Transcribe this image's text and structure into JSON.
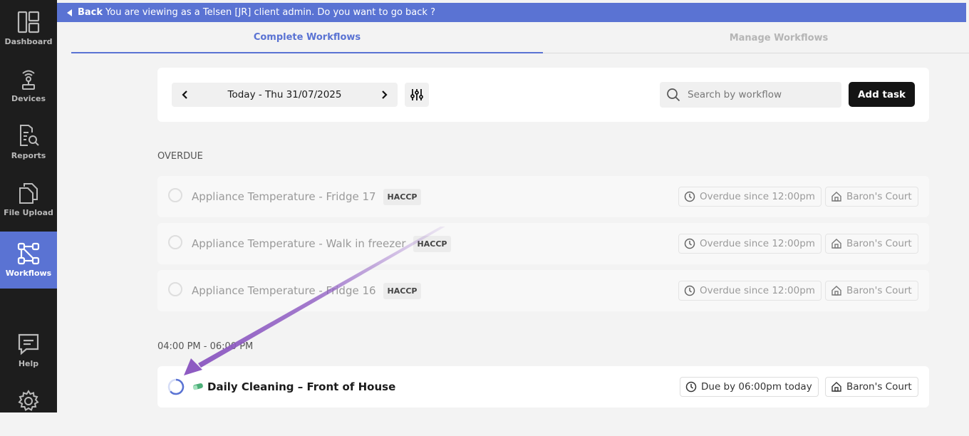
{
  "sidebar": {
    "items": [
      {
        "label": "Dashboard",
        "icon": "dashboard-icon"
      },
      {
        "label": "Devices",
        "icon": "devices-icon"
      },
      {
        "label": "Reports",
        "icon": "reports-icon"
      },
      {
        "label": "File Upload",
        "icon": "file-upload-icon"
      },
      {
        "label": "Workflows",
        "icon": "workflows-icon",
        "active": true
      },
      {
        "label": "Help",
        "icon": "help-icon"
      },
      {
        "label": "",
        "icon": "settings-icon"
      }
    ]
  },
  "banner": {
    "back_label": "Back",
    "message": "You are viewing as a Telsen [JR] client admin. Do you want to go back ?"
  },
  "tabs": [
    {
      "label": "Complete Workflows",
      "active": true
    },
    {
      "label": "Manage Workflows",
      "active": false
    }
  ],
  "toolbar": {
    "date_label": "Today - Thu 31/07/2025",
    "search_placeholder": "Search by workflow",
    "add_task_label": "Add task"
  },
  "sections": {
    "overdue_label": "OVERDUE",
    "timeslot_label": "04:00 PM - 06:00 PM"
  },
  "overdue_tasks": [
    {
      "title": "Appliance Temperature - Fridge 17",
      "tag": "HACCP",
      "status": "Overdue since 12:00pm",
      "location": "Baron's Court"
    },
    {
      "title": "Appliance Temperature - Walk in freezer",
      "tag": "HACCP",
      "status": "Overdue since 12:00pm",
      "location": "Baron's Court"
    },
    {
      "title": "Appliance Temperature - Fridge 16",
      "tag": "HACCP",
      "status": "Overdue since 12:00pm",
      "location": "Baron's Court"
    }
  ],
  "timeslot_tasks": [
    {
      "title": "Daily Cleaning – Front of House",
      "status": "Due by 06:00pm today",
      "location": "Baron's Court"
    }
  ],
  "colors": {
    "accent": "#5a73d3",
    "sidebar_bg": "#1d1d1d",
    "annotation_arrow": "#8e5bc2"
  }
}
